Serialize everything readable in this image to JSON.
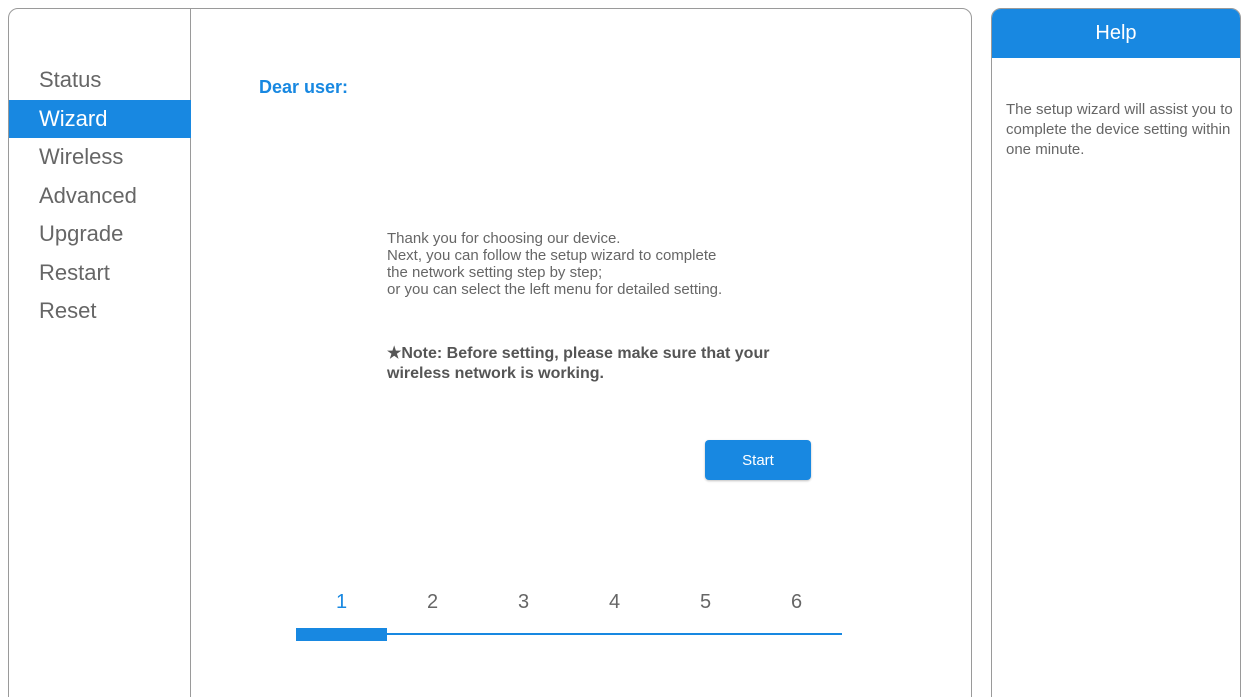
{
  "sidebar": {
    "items": [
      {
        "label": "Status",
        "active": false
      },
      {
        "label": "Wizard",
        "active": true
      },
      {
        "label": "Wireless",
        "active": false
      },
      {
        "label": "Advanced",
        "active": false
      },
      {
        "label": "Upgrade",
        "active": false
      },
      {
        "label": "Restart",
        "active": false
      },
      {
        "label": "Reset",
        "active": false
      }
    ]
  },
  "main": {
    "greeting": "Dear user:",
    "intro_lines": [
      "Thank you for choosing our device.",
      "Next, you can follow the setup wizard to complete",
      "the network setting step by step;",
      "or you can select the left menu for detailed setting."
    ],
    "note": "★Note: Before setting, please make sure that your wireless network is working.",
    "start_label": "Start",
    "steps": [
      "1",
      "2",
      "3",
      "4",
      "5",
      "6"
    ],
    "current_step": 1
  },
  "help": {
    "title": "Help",
    "text": "The setup wizard will assist you to complete the device setting within one minute."
  },
  "colors": {
    "accent": "#1888e1",
    "text": "#666666",
    "border": "#9a9a9a"
  }
}
